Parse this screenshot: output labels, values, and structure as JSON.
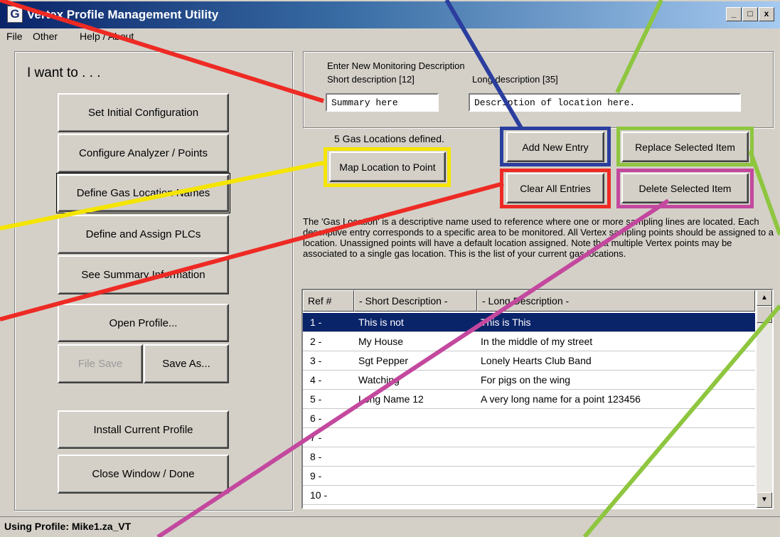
{
  "window": {
    "title": "Vertex Profile Management Utility",
    "icon": "vertex-app-icon",
    "controls": {
      "minimize": "_",
      "maximize": "□",
      "close": "x"
    }
  },
  "menu": [
    "File",
    "Other",
    "Help / About"
  ],
  "left_panel": {
    "heading": "I want to . . .",
    "buttons": {
      "set_initial": "Set Initial Configuration",
      "configure_analyzer": "Configure Analyzer / Points",
      "define_gas": "Define Gas Location Names",
      "define_plcs": "Define and Assign PLCs",
      "see_summary": "See Summary Information",
      "open_profile": "Open Profile...",
      "file_save": "File Save",
      "save_as": "Save As...",
      "install_profile": "Install Current Profile",
      "close_window": "Close Window / Done"
    }
  },
  "entry": {
    "heading": "Enter New Monitoring Description",
    "short_label": "Short description [12]",
    "long_label": "Long description [35]",
    "short_value": "Summary here",
    "long_value": "Description of location here."
  },
  "locations_count_text": "5  Gas Locations defined.",
  "buttons": {
    "map_location": "Map Location to Point",
    "add_new": "Add New Entry",
    "replace_selected": "Replace Selected Item",
    "clear_all": "Clear All Entries",
    "delete_selected": "Delete Selected Item"
  },
  "info_text": "The 'Gas Location' is a descriptive name used to reference where one or more sampling lines are located.  Each descriptive entry corresponds to a specific area to be monitored.   All Vertex sampling points should be assigned to a location. Unassigned points will have a default location assigned. Note that multiple Vertex points may be associated to a single gas location.  This is the list of your current gas locations.",
  "table": {
    "headers": [
      "Ref #",
      "- Short Description -",
      "- Long Description -"
    ],
    "rows": [
      {
        "ref": "1 -",
        "short": "This is not",
        "long": "This is This"
      },
      {
        "ref": "2 -",
        "short": "My House",
        "long": "In the middle of my street"
      },
      {
        "ref": "3 -",
        "short": "Sgt Pepper",
        "long": "Lonely Hearts Club Band"
      },
      {
        "ref": "4 -",
        "short": "Watching",
        "long": "For pigs on the wing"
      },
      {
        "ref": "5 -",
        "short": "Long Name 12",
        "long": "A very long name for a point 123456"
      },
      {
        "ref": "6 -",
        "short": "",
        "long": ""
      },
      {
        "ref": "7 -",
        "short": "",
        "long": ""
      },
      {
        "ref": "8 -",
        "short": "",
        "long": ""
      },
      {
        "ref": "9 -",
        "short": "",
        "long": ""
      },
      {
        "ref": "10 -",
        "short": "",
        "long": ""
      }
    ],
    "selected_row": 0
  },
  "status": {
    "text": "Using Profile:  Mike1.za_VT"
  },
  "highlight_colors": {
    "yellow": "#f4e400",
    "red": "#ee2a24",
    "blue": "#2b3e9e",
    "green": "#8ec63f",
    "magenta": "#c3489e"
  }
}
